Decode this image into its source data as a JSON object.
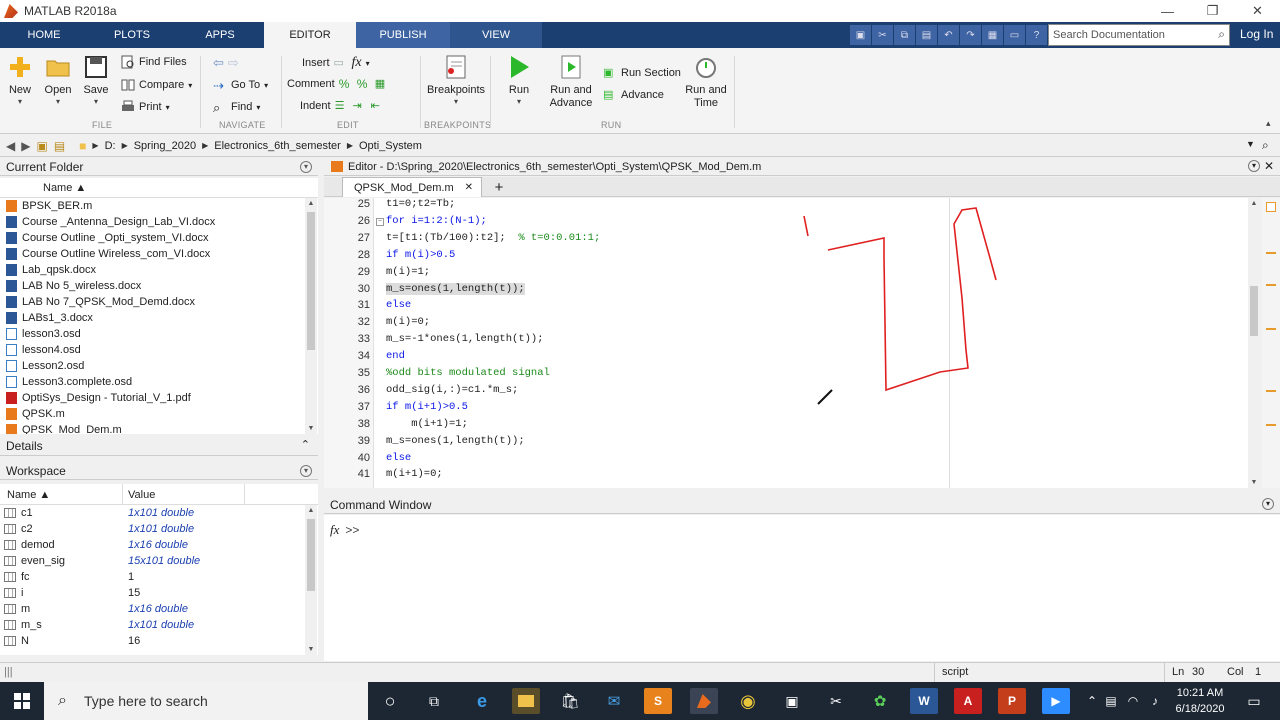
{
  "window": {
    "title": "MATLAB R2018a",
    "minimize": "—",
    "restore": "❐",
    "close": "✕"
  },
  "ribbon_tabs": [
    "HOME",
    "PLOTS",
    "APPS",
    "EDITOR",
    "PUBLISH",
    "VIEW"
  ],
  "search": {
    "placeholder": "Search Documentation"
  },
  "login_label": "Log In",
  "ribbon": {
    "file": {
      "new": "New",
      "open": "Open",
      "save": "Save",
      "find_files": "Find Files",
      "compare": "Compare",
      "print": "Print",
      "group": "FILE"
    },
    "navigate": {
      "go_to": "Go To",
      "find": "Find",
      "group": "NAVIGATE"
    },
    "edit": {
      "insert": "Insert",
      "comment": "Comment",
      "indent": "Indent",
      "fx": "fx",
      "group": "EDIT"
    },
    "breakpoints": {
      "label": "Breakpoints",
      "group": "BREAKPOINTS"
    },
    "run": {
      "run": "Run",
      "run_and_advance_1": "Run and",
      "run_and_advance_2": "Advance",
      "run_section": "Run Section",
      "advance": "Advance",
      "run_and_time_1": "Run and",
      "run_and_time_2": "Time",
      "group": "RUN"
    }
  },
  "address": {
    "crumbs": [
      "D:",
      "Spring_2020",
      "Electronics_6th_semester",
      "Opti_System"
    ]
  },
  "current_folder": {
    "title": "Current Folder",
    "column": "Name ▲",
    "files": [
      {
        "name": "BPSK_BER.m",
        "type": "m"
      },
      {
        "name": "Course _Antenna_Design_Lab_VI.docx",
        "type": "doc"
      },
      {
        "name": "Course Outline _Opti_system_VI.docx",
        "type": "doc"
      },
      {
        "name": "Course Outline Wireless_com_VI.docx",
        "type": "doc"
      },
      {
        "name": "Lab_qpsk.docx",
        "type": "doc"
      },
      {
        "name": "LAB No 5_wireless.docx",
        "type": "doc"
      },
      {
        "name": "LAB No 7_QPSK_Mod_Demd.docx",
        "type": "doc"
      },
      {
        "name": "LABs1_3.docx",
        "type": "doc"
      },
      {
        "name": "lesson3.osd",
        "type": "osd"
      },
      {
        "name": "lesson4.osd",
        "type": "osd"
      },
      {
        "name": "Lesson2.osd",
        "type": "osd"
      },
      {
        "name": "Lesson3.complete.osd",
        "type": "osd"
      },
      {
        "name": "OptiSys_Design - Tutorial_V_1.pdf",
        "type": "pdf"
      },
      {
        "name": "QPSK.m",
        "type": "m"
      },
      {
        "name": "QPSK_Mod_Dem.m",
        "type": "m"
      }
    ]
  },
  "details": {
    "title": "Details"
  },
  "workspace": {
    "title": "Workspace",
    "col_name": "Name ▲",
    "col_value": "Value",
    "vars": [
      {
        "name": "c1",
        "value": "1x101 double",
        "matrix": true
      },
      {
        "name": "c2",
        "value": "1x101 double",
        "matrix": true
      },
      {
        "name": "demod",
        "value": "1x16 double",
        "matrix": true
      },
      {
        "name": "even_sig",
        "value": "15x101 double",
        "matrix": true
      },
      {
        "name": "fc",
        "value": "1",
        "matrix": false
      },
      {
        "name": "i",
        "value": "15",
        "matrix": false
      },
      {
        "name": "m",
        "value": "1x16 double",
        "matrix": true
      },
      {
        "name": "m_s",
        "value": "1x101 double",
        "matrix": true
      },
      {
        "name": "N",
        "value": "16",
        "matrix": false
      }
    ]
  },
  "editor": {
    "header": "Editor - D:\\Spring_2020\\Electronics_6th_semester\\Opti_System\\QPSK_Mod_Dem.m",
    "tab": "QPSK_Mod_Dem.m",
    "lines": [
      {
        "n": "25",
        "code": "t1=0;t2=Tb;"
      },
      {
        "n": "26",
        "code": "for i=1:2:(N-1);",
        "fold": true
      },
      {
        "n": "27",
        "code": "t=[t1:(Tb/100):t2];  ",
        "comment": "% t=0:0.01:1;"
      },
      {
        "n": "28",
        "code": "if m(i)>0.5"
      },
      {
        "n": "29",
        "code": "m(i)=1;"
      },
      {
        "n": "30",
        "code": "m_s=ones(1,length(t));",
        "highlight": true
      },
      {
        "n": "31",
        "code": "else"
      },
      {
        "n": "32",
        "code": "m(i)=0;"
      },
      {
        "n": "33",
        "code": "m_s=-1*ones(1,length(t));"
      },
      {
        "n": "34",
        "code": "end"
      },
      {
        "n": "35",
        "code": "",
        "comment": "%odd bits modulated signal"
      },
      {
        "n": "36",
        "code": "odd_sig(i,:)=c1.*m_s;"
      },
      {
        "n": "37",
        "code": "if m(i+1)>0.5"
      },
      {
        "n": "38",
        "code": "    m(i+1)=1;"
      },
      {
        "n": "39",
        "code": "m_s=ones(1,length(t));"
      },
      {
        "n": "40",
        "code": "else"
      },
      {
        "n": "41",
        "code": "m(i+1)=0;"
      }
    ]
  },
  "command_window": {
    "title": "Command Window",
    "fx": "fx",
    "prompt": ">>"
  },
  "status": {
    "mode": "script",
    "ln_label": "Ln",
    "ln": "30",
    "col_label": "Col",
    "col": "1"
  },
  "taskbar": {
    "search_placeholder": "Type here to search",
    "time": "10:21 AM",
    "date": "6/18/2020"
  },
  "colors": {
    "tabstrip": "#1c3f72",
    "keyword": "#0b16e8",
    "comment": "#1b8a1b",
    "annotation": "#e02020"
  }
}
